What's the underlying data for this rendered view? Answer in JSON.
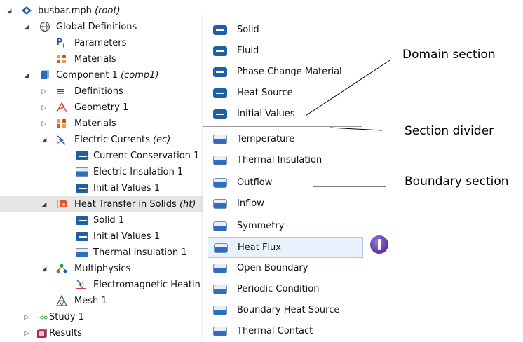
{
  "tree": {
    "root": {
      "label": "busbar.mph",
      "tag": "(root)"
    },
    "global_definitions": {
      "label": "Global Definitions"
    },
    "parameters": {
      "label": "Parameters"
    },
    "materials_global": {
      "label": "Materials"
    },
    "component": {
      "label": "Component 1",
      "tag": "(comp1)"
    },
    "definitions": {
      "label": "Definitions"
    },
    "geometry": {
      "label": "Geometry 1"
    },
    "materials_comp": {
      "label": "Materials"
    },
    "electric_currents": {
      "label": "Electric Currents",
      "tag": "(ec)"
    },
    "current_conservation": {
      "label": "Current Conservation 1"
    },
    "electric_insulation": {
      "label": "Electric Insulation 1"
    },
    "initial_values_ec": {
      "label": "Initial Values 1"
    },
    "heat_transfer": {
      "label": "Heat Transfer in Solids",
      "tag": "(ht)"
    },
    "solid": {
      "label": "Solid 1"
    },
    "initial_values_ht": {
      "label": "Initial Values 1"
    },
    "thermal_insulation": {
      "label": "Thermal Insulation 1"
    },
    "multiphysics": {
      "label": "Multiphysics"
    },
    "electromagnetic_heating": {
      "label": "Electromagnetic Heatin"
    },
    "mesh": {
      "label": "Mesh 1"
    },
    "study": {
      "label": "Study 1"
    },
    "results": {
      "label": "Results"
    }
  },
  "menu": {
    "domain_items": [
      "Solid",
      "Fluid",
      "Phase Change Material",
      "Heat Source",
      "Initial Values"
    ],
    "boundary_items": [
      "Temperature",
      "Thermal Insulation",
      "Outflow",
      "Inflow",
      "Symmetry",
      "Heat Flux",
      "Open Boundary",
      "Periodic Condition",
      "Boundary Heat Source",
      "Thermal Contact"
    ],
    "hovered_item": "Heat Flux"
  },
  "callouts": {
    "domain_section": "Domain section",
    "section_divider": "Section divider",
    "boundary_section": "Boundary section"
  },
  "colors": {
    "domain_icon": "#1f5fa6",
    "boundary_icon": "#2c6fbf",
    "hover": "#e8f2fc",
    "selected_row": "#e6e6e6"
  }
}
